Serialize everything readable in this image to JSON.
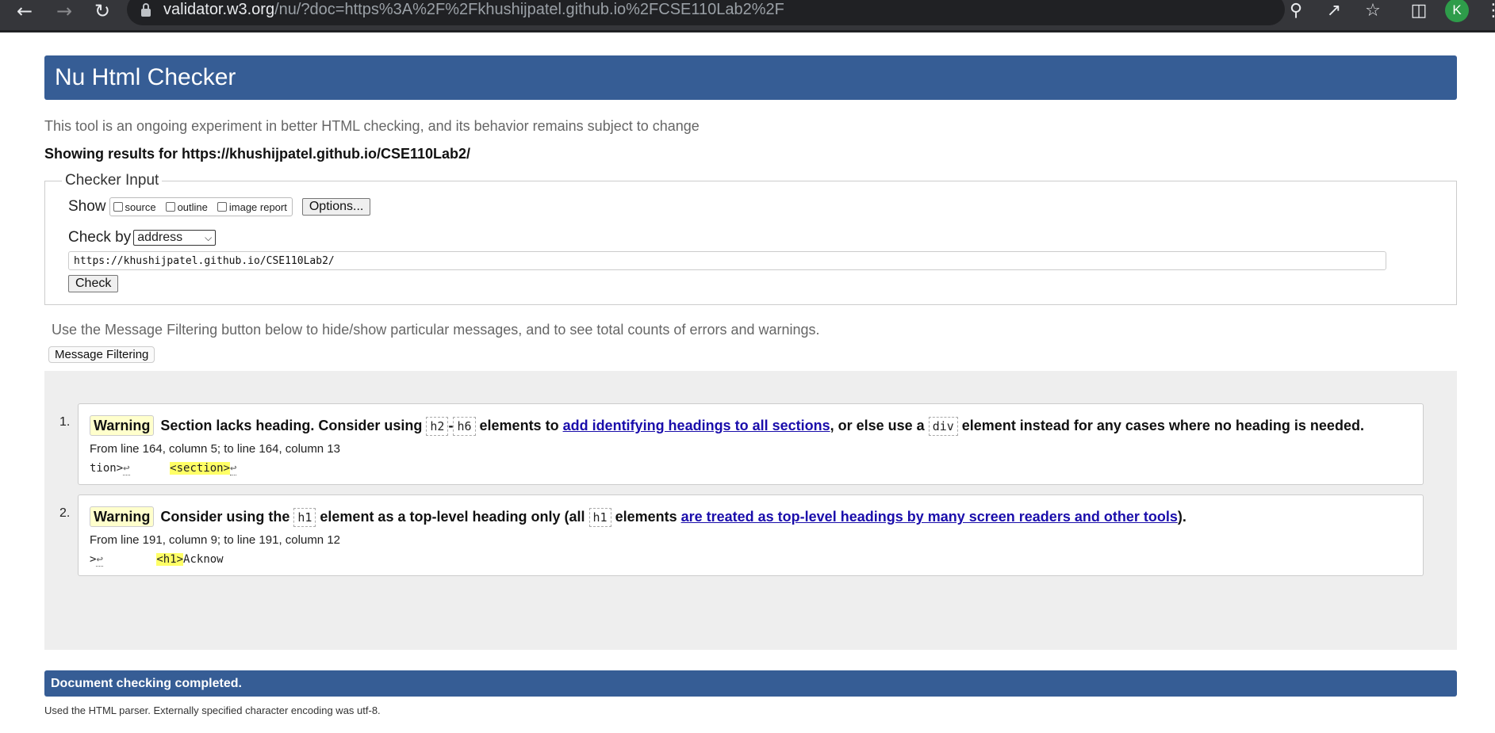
{
  "browser": {
    "url_host": "validator.w3.org",
    "url_path": "/nu/?doc=https%3A%2F%2Fkhushijpatel.github.io%2FCSE110Lab2%2F",
    "profile_initial": "K"
  },
  "header": {
    "title": "Nu Html Checker"
  },
  "intro_text": "This tool is an ongoing experiment in better HTML checking, and its behavior remains subject to change",
  "showing_results": "Showing results for https://khushijpatel.github.io/CSE110Lab2/",
  "checker": {
    "legend": "Checker Input",
    "show_label": "Show",
    "show_options": {
      "source": "source",
      "outline": "outline",
      "image_report": "image report"
    },
    "options_button": "Options...",
    "checkby_label": "Check by",
    "checkby_value": "address",
    "url_value": "https://khushijpatel.github.io/CSE110Lab2/",
    "check_button": "Check"
  },
  "filter_note": "Use the Message Filtering button below to hide/show particular messages, and to see total counts of errors and warnings.",
  "filter_button": "Message Filtering",
  "messages": [
    {
      "num": "1.",
      "type": "Warning",
      "t1": "Section lacks heading. Consider using ",
      "c1": "h2",
      "t2": "-",
      "c2": "h6",
      "t3": " elements to ",
      "link": "add identifying headings to all sections",
      "t4": ", or else use a ",
      "c3": "div",
      "t5": " element instead for any cases where no heading is needed.",
      "location": "From line 164, column 5; to line 164, column 13",
      "ext_before": "tion>",
      "ext_highlight": "<section>",
      "lb": "↩"
    },
    {
      "num": "2.",
      "type": "Warning",
      "t1": "Consider using the ",
      "c1": "h1",
      "t2": " element as a top-level heading only (all ",
      "c2": "h1",
      "t3": " elements ",
      "link": "are treated as top-level headings by many screen readers and other tools",
      "t4": ").",
      "location": "From line 191, column 9; to line 191, column 12",
      "ext_before": ">",
      "ext_highlight": "<h1>",
      "ext_after": "Acknow",
      "lb": "↩"
    }
  ],
  "done_text": "Document checking completed.",
  "parser_note": "Used the HTML parser. Externally specified character encoding was utf-8.",
  "colors": {
    "header_bg": "#365d95",
    "warning_bg": "#ffffcc",
    "highlight": "#ffff66",
    "link": "#1a0dab"
  },
  "icons": [
    "back-arrow-icon",
    "forward-arrow-icon",
    "reload-icon",
    "lock-icon",
    "zoom-icon",
    "share-icon",
    "star-icon",
    "sidepanel-icon",
    "kebab-menu-icon",
    "chevron-down-icon",
    "return-icon"
  ]
}
